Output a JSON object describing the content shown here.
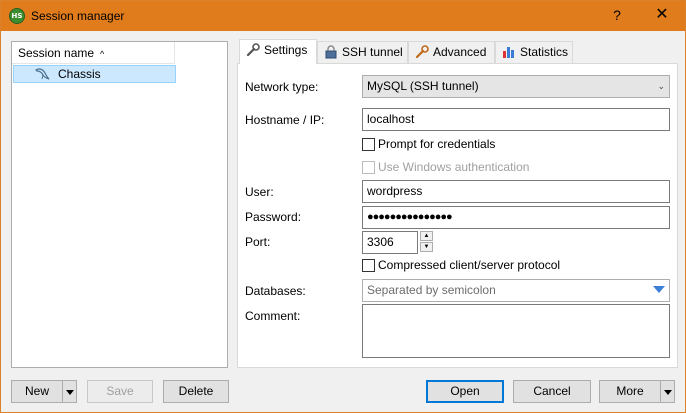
{
  "window": {
    "title": "Session manager",
    "app_icon_text": "HS",
    "help_symbol": "?",
    "close_symbol": "✕"
  },
  "sessions": {
    "column_header": "Session name",
    "sort_symbol": "^",
    "items": [
      {
        "label": "Chassis",
        "selected": true
      }
    ]
  },
  "tabs": [
    {
      "label": "Settings",
      "icon": "wrench-icon",
      "active": true
    },
    {
      "label": "SSH tunnel",
      "icon": "lock-icon",
      "active": false
    },
    {
      "label": "Advanced",
      "icon": "wrench-icon",
      "active": false
    },
    {
      "label": "Statistics",
      "icon": "bar-chart-icon",
      "active": false
    }
  ],
  "settings": {
    "network_type_label": "Network type:",
    "network_type_value": "MySQL (SSH tunnel)",
    "hostname_label": "Hostname / IP:",
    "hostname_value": "localhost",
    "prompt_credentials_label": "Prompt for credentials",
    "prompt_credentials_checked": false,
    "windows_auth_label": "Use Windows authentication",
    "windows_auth_checked": false,
    "user_label": "User:",
    "user_value": "wordpress",
    "password_label": "Password:",
    "password_value": "●●●●●●●●●●●●●●●",
    "port_label": "Port:",
    "port_value": "3306",
    "compressed_label": "Compressed client/server protocol",
    "compressed_checked": false,
    "databases_label": "Databases:",
    "databases_placeholder": "Separated by semicolon",
    "comment_label": "Comment:",
    "comment_value": ""
  },
  "buttons": {
    "new": "New",
    "save": "Save",
    "delete": "Delete",
    "open": "Open",
    "cancel": "Cancel",
    "more": "More"
  },
  "colors": {
    "titlebar": "#e07c1b",
    "selection": "#cce8ff",
    "focus": "#0078d7"
  }
}
